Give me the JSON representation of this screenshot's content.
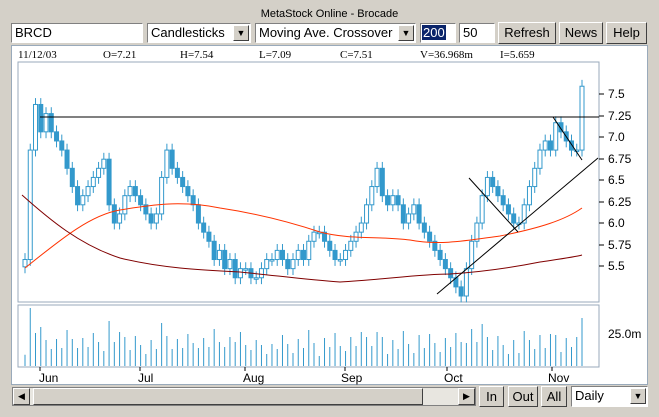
{
  "window_title": "MetaStock Online - Brocade",
  "symbol": "BRCD",
  "chart_style": "Candlesticks",
  "indicator": "Moving Ave. Crossover",
  "ma_period_1": "200",
  "ma_period_2": "50",
  "buttons": {
    "refresh": "Refresh",
    "news": "News",
    "help": "Help"
  },
  "quote": {
    "date": "11/12/03",
    "open": "O=7.21",
    "high": "H=7.54",
    "low": "L=7.09",
    "close": "C=7.51",
    "volume": "V=36.968m",
    "i": "I=5.659"
  },
  "price_axis": [
    "7.5",
    "7.25",
    "7.0",
    "6.75",
    "6.5",
    "6.25",
    "6.0",
    "5.75",
    "5.5"
  ],
  "volume_axis": [
    "25.0m"
  ],
  "months": [
    "Jun",
    "Jul",
    "Aug",
    "Sep",
    "Oct",
    "Nov"
  ],
  "bottom": {
    "in": "In",
    "out": "Out",
    "all": "All",
    "period": "Daily"
  },
  "colors": {
    "candle": "#3399cc",
    "ma_short": "#ff3300",
    "ma_long": "#800000",
    "panel_border": "#99aabb"
  },
  "chart_data": {
    "type": "candlestick",
    "ylim": [
      5.2,
      7.7
    ],
    "closes": [
      5.6,
      6.8,
      7.3,
      7.0,
      7.2,
      7.0,
      6.9,
      6.8,
      6.6,
      6.4,
      6.2,
      6.3,
      6.4,
      6.5,
      6.6,
      6.7,
      6.2,
      6.0,
      6.1,
      6.3,
      6.4,
      6.3,
      6.2,
      6.1,
      6.0,
      6.1,
      6.5,
      6.8,
      6.6,
      6.5,
      6.4,
      6.3,
      6.2,
      6.0,
      5.9,
      5.8,
      5.6,
      5.7,
      5.5,
      5.6,
      5.4,
      5.5,
      5.5,
      5.4,
      5.4,
      5.5,
      5.6,
      5.6,
      5.7,
      5.6,
      5.5,
      5.6,
      5.7,
      5.6,
      5.8,
      5.9,
      5.9,
      5.8,
      5.7,
      5.6,
      5.6,
      5.7,
      5.8,
      5.9,
      6.0,
      6.2,
      6.4,
      6.6,
      6.3,
      6.2,
      6.3,
      6.2,
      6.0,
      6.1,
      6.2,
      6.0,
      5.9,
      5.8,
      5.7,
      5.6,
      5.5,
      5.4,
      5.3,
      5.2,
      5.5,
      5.8,
      6.0,
      6.3,
      6.5,
      6.4,
      6.3,
      6.2,
      6.1,
      6.0,
      6.0,
      6.2,
      6.4,
      6.6,
      6.8,
      6.9,
      6.8,
      7.1,
      7.0,
      6.9,
      6.8,
      6.8,
      7.5
    ]
  }
}
